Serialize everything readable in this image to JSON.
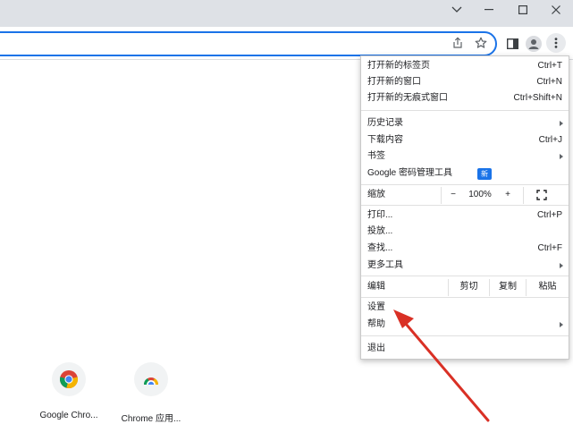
{
  "window": {
    "controls": [
      "chevron-down-icon",
      "minimize-icon",
      "maximize-icon",
      "close-icon"
    ]
  },
  "toolbar": {
    "icons": [
      "share-icon",
      "star-icon",
      "side-panel-icon",
      "profile-icon",
      "more-vert-icon"
    ]
  },
  "menu": {
    "group1": [
      {
        "label": "打开新的标签页",
        "shortcut": "Ctrl+T"
      },
      {
        "label": "打开新的窗口",
        "shortcut": "Ctrl+N"
      },
      {
        "label": "打开新的无痕式窗口",
        "shortcut": "Ctrl+Shift+N"
      }
    ],
    "group2": [
      {
        "label": "历史记录",
        "shortcut": ""
      },
      {
        "label": "下载内容",
        "shortcut": "Ctrl+J"
      },
      {
        "label": "书签",
        "shortcut": ""
      },
      {
        "label": "Google 密码管理工具",
        "shortcut": ""
      }
    ],
    "new_badge": "新",
    "zoom": {
      "label": "缩放",
      "minus": "−",
      "value": "100%",
      "plus": "+"
    },
    "group3": [
      {
        "label": "打印...",
        "shortcut": "Ctrl+P"
      },
      {
        "label": "投放...",
        "shortcut": ""
      },
      {
        "label": "查找...",
        "shortcut": "Ctrl+F"
      },
      {
        "label": "更多工具",
        "shortcut": ""
      }
    ],
    "edit": {
      "label": "编辑",
      "cut": "剪切",
      "copy": "复制",
      "paste": "粘贴"
    },
    "group4": [
      {
        "label": "设置"
      },
      {
        "label": "帮助"
      }
    ],
    "exit": "退出"
  },
  "shortcuts": [
    {
      "label": "Google Chro...",
      "icon": "chrome-icon"
    },
    {
      "label": "Chrome 应用...",
      "icon": "chrome-apps-icon"
    }
  ],
  "colors": {
    "accent": "#1a73e8",
    "annotation_arrow": "#d93025",
    "titlebar": "#dee1e6"
  }
}
